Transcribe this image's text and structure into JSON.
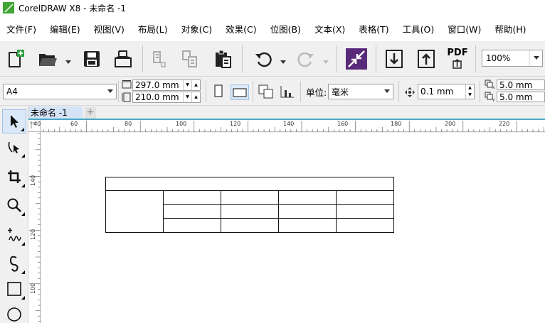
{
  "app": {
    "title": "CorelDRAW X8 - 未命名 -1",
    "logo_icon": "coreldraw-logo-icon"
  },
  "menu": [
    {
      "label": "文件(F)"
    },
    {
      "label": "编辑(E)"
    },
    {
      "label": "视图(V)"
    },
    {
      "label": "布局(L)"
    },
    {
      "label": "对象(C)"
    },
    {
      "label": "效果(C)"
    },
    {
      "label": "位图(B)"
    },
    {
      "label": "文本(X)"
    },
    {
      "label": "表格(T)"
    },
    {
      "label": "工具(O)"
    },
    {
      "label": "窗口(W)"
    },
    {
      "label": "帮助(H)"
    }
  ],
  "toolbar": {
    "icons": [
      "new-document-icon",
      "open-icon",
      "save-icon",
      "print-icon",
      "cut-icon",
      "copy-icon",
      "paste-icon",
      "undo-icon",
      "redo-icon",
      "search-content-icon",
      "import-icon",
      "export-icon",
      "publish-pdf-icon"
    ],
    "pdf_label": "PDF",
    "zoom_value": "100%"
  },
  "propbar": {
    "page_size": "A4",
    "width": "297.0 mm",
    "height": "210.0 mm",
    "units_label": "单位:",
    "units_value": "毫米",
    "nudge": "0.1 mm",
    "dup_x": "5.0 mm",
    "dup_y": "5.0 mm"
  },
  "tabs": {
    "doc": "未命名 -1",
    "add": "+"
  },
  "ruler": {
    "h_labels": [
      "40",
      "60",
      "80",
      "100",
      "120",
      "140",
      "160",
      "180",
      "200",
      "220"
    ],
    "v_labels": [
      "140",
      "120",
      "100"
    ]
  },
  "toolbox": {
    "icons": [
      "pick-tool-icon",
      "shape-tool-icon",
      "crop-tool-icon",
      "zoom-tool-icon",
      "freehand-tool-icon",
      "artistic-media-icon",
      "rectangle-tool-icon",
      "ellipse-tool-icon"
    ]
  },
  "colors": {
    "accent": "#4aa8c8",
    "tab_bg": "#d4e3f6",
    "logo_green": "#3fa535"
  }
}
